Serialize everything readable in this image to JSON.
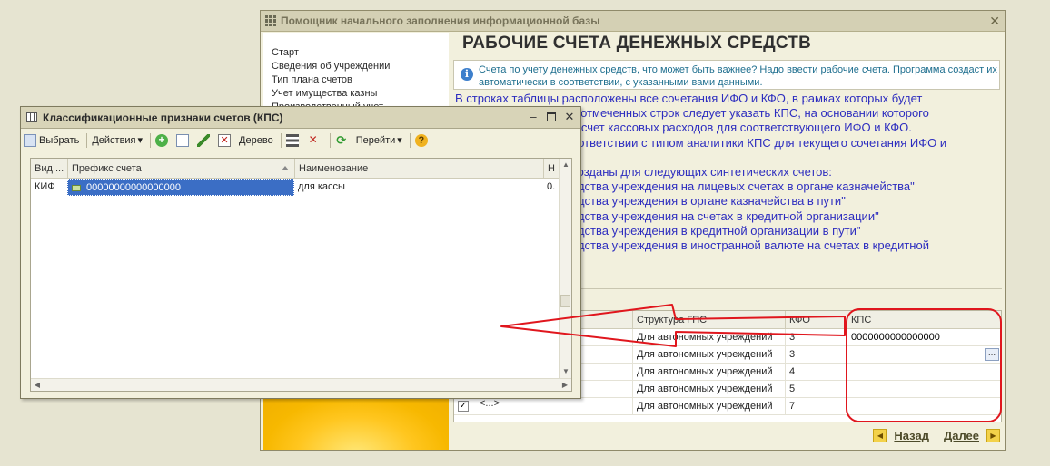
{
  "wizard": {
    "title": "Помощник начального заполнения информационной базы",
    "close_glyph": "✕",
    "nav": [
      "Старт",
      "Сведения об учреждении",
      "Тип плана счетов",
      "Учет имущества казны",
      "Производственный учет"
    ],
    "heading": "РАБОЧИЕ СЧЕТА ДЕНЕЖНЫХ СРЕДСТВ",
    "info_lines": [
      "Счета по учету денежных средств, что может быть важнее? Надо ввести рабочие счета. Программа создаст их",
      "автоматически в соответствии, с указанными вами данными."
    ],
    "body_lines": [
      "В строках таблицы расположены все сочетания ИФО и КФО, в рамках которых будет",
      "х отмеченных строк следует указать КПС, на основании которого",
      "й счет кассовых расходов для соответствующего ИФО и КФО.",
      "оответствии с типом аналитики КПС для текущего сочетания ИФО и"
    ],
    "body_lines_2": [
      "созданы для следующих синтетических счетов:",
      "едства учреждения на лицевых счетах в органе казначейства\"",
      "едства учреждения в органе казначейства в пути\"",
      "едства учреждения на счетах в кредитной организации\"",
      "едства учреждения в кредитной организации в пути\"",
      "едства учреждения в иностранной валюте на счетах в кредитной"
    ],
    "section_caption": "цы",
    "table": {
      "headers": [
        "Структура ГПС",
        "КФО",
        "КПС"
      ],
      "rows": [
        {
          "struct": "Для автономных учреждений",
          "kfo": "3",
          "kps": "0000000000000000"
        },
        {
          "struct": "Для автономных учреждений",
          "kfo": "3",
          "kps": ""
        },
        {
          "struct": "Для автономных учреждений",
          "kfo": "4",
          "kps": ""
        },
        {
          "struct": "Для автономных учреждений",
          "kfo": "5",
          "kps": ""
        },
        {
          "struct": "Для автономных учреждений",
          "kfo": "7",
          "kps": ""
        }
      ],
      "last_row_prefix": "<...>",
      "dots_label": "..."
    },
    "back_label": "Назад",
    "next_label": "Далее",
    "back_glyph": "◀",
    "next_glyph": "▶"
  },
  "popup": {
    "title": "Классификационные признаки счетов (КПС)",
    "toolbar": {
      "select": "Выбрать",
      "actions": "Действия",
      "tree": "Дерево",
      "goto": "Перейти",
      "dropdown_glyph": "▾"
    },
    "icons": {
      "plus": "+",
      "delete": "✕",
      "filter_off": "✕",
      "refresh": "⟳",
      "help": "?"
    },
    "columns": [
      "Вид ...",
      "Префикс счета",
      "Наименование",
      "Н"
    ],
    "rows": [
      {
        "kind": "КИФ",
        "prefix": "00000000000000000",
        "name": "для кассы",
        "n": "0."
      }
    ],
    "window_buttons": {
      "minimize": "–",
      "close": "✕"
    },
    "scroll": {
      "up": "▲",
      "down": "▼",
      "left": "◀",
      "right": "▶"
    }
  },
  "colors": {
    "annotation_red": "#e0161d",
    "body_text_blue": "#2d2dbf",
    "selection_blue": "#3b6ec5"
  }
}
